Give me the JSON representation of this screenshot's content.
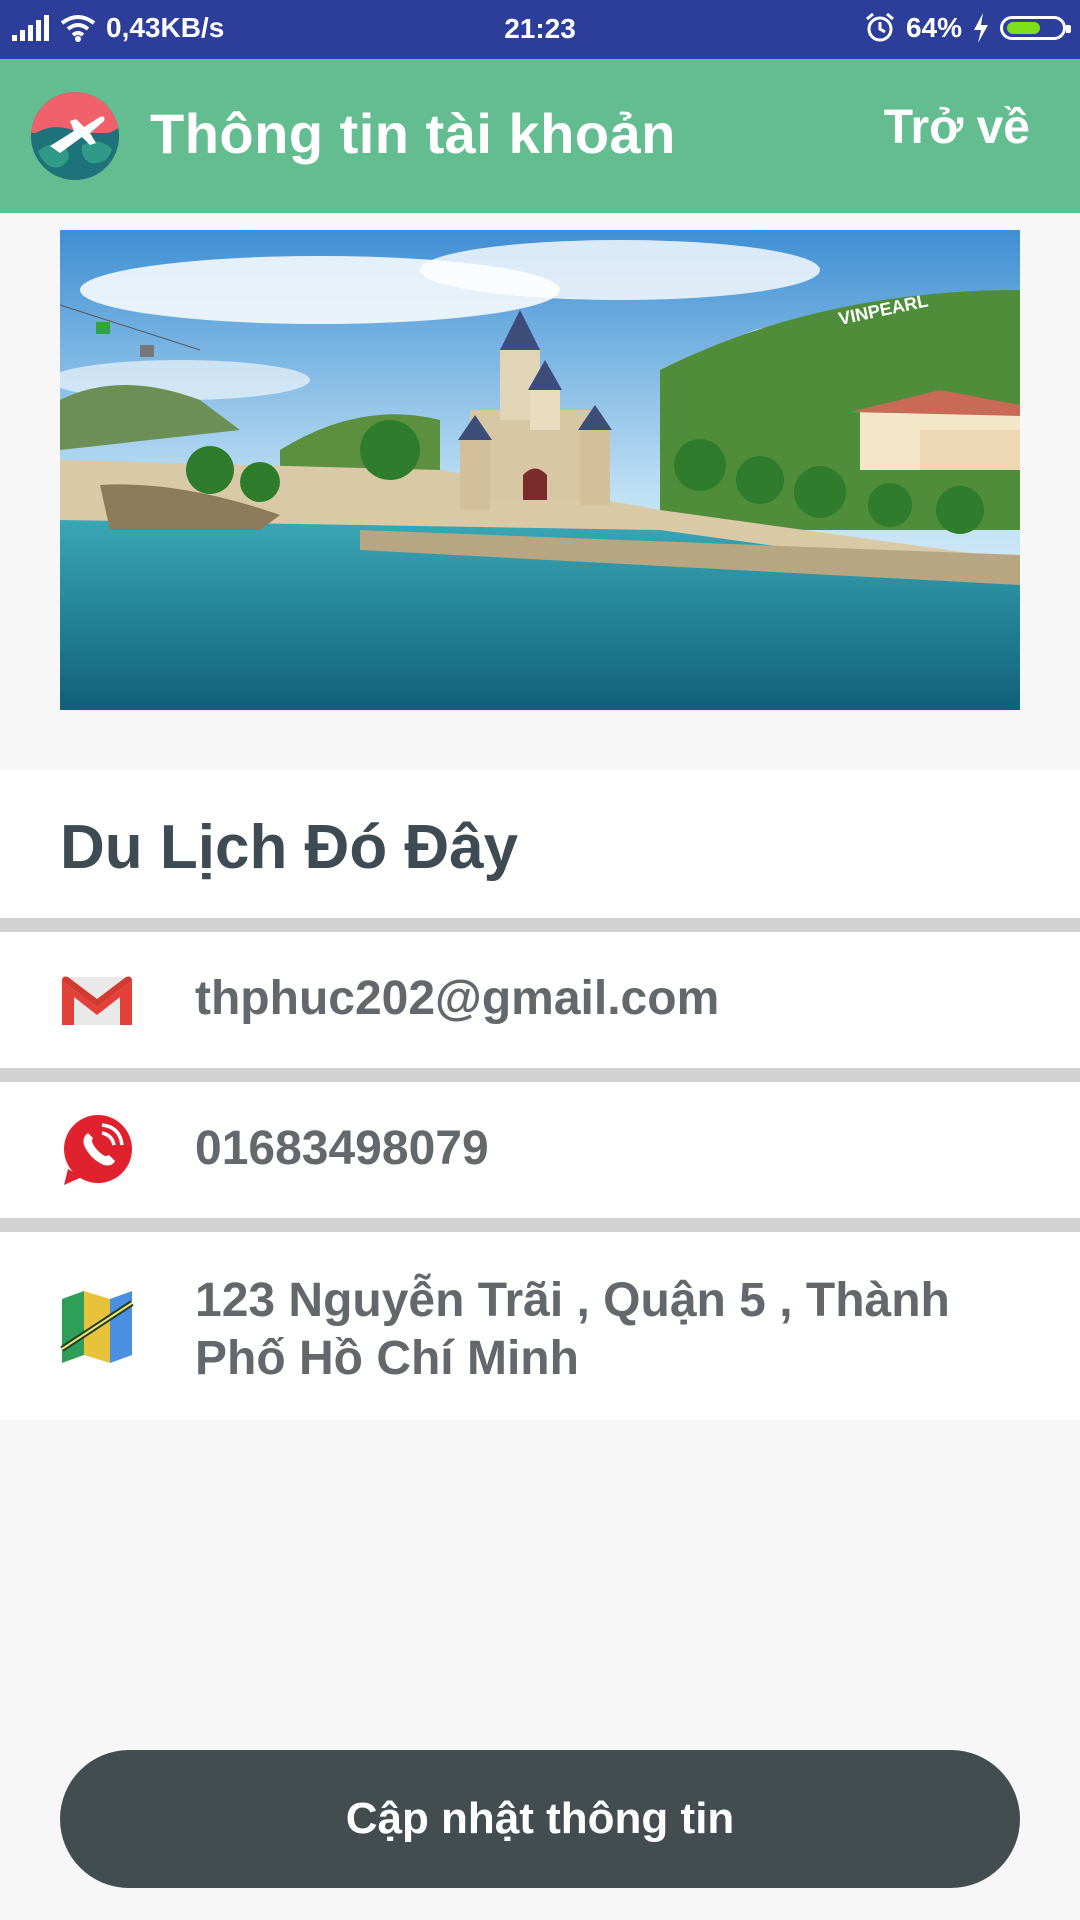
{
  "status_bar": {
    "network_speed": "0,43KB/s",
    "time": "21:23",
    "battery_percent": "64%",
    "battery_level": 0.64,
    "icons": [
      "signal-icon",
      "wifi-icon",
      "alarm-icon",
      "charging-icon",
      "battery-icon"
    ]
  },
  "app_bar": {
    "title": "Thông tin tài khoản",
    "back_label": "Trở về",
    "logo_icon": "globe-plane-icon",
    "color": "#63bd91"
  },
  "banner": {
    "sign_text": "VINPEARL"
  },
  "profile": {
    "name": "Du Lịch Đó Đây",
    "email": "thphuc202@gmail.com",
    "phone": "01683498079",
    "address": "123 Nguyễn Trãi , Quận 5 , Thành Phố Hồ Chí Minh"
  },
  "icons": {
    "email": "gmail-icon",
    "phone": "phone-call-icon",
    "address": "map-icon"
  },
  "actions": {
    "update_label": "Cập nhật thông tin"
  },
  "colors": {
    "status_bar": "#2d3d9a",
    "app_bar": "#63bd91",
    "button": "#434d50",
    "text_dark": "#3e4b52",
    "text_gray": "#62686b"
  }
}
